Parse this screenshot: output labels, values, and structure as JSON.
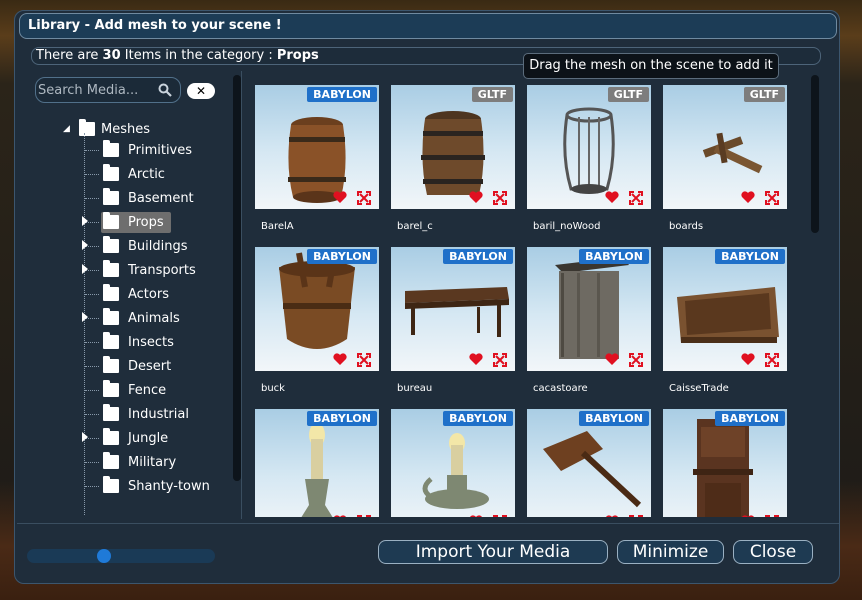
{
  "window": {
    "title": "Library - Add mesh to your scene !"
  },
  "info": {
    "prefix": "There are",
    "count": "30",
    "middle": "Items in the category :",
    "category": "Props"
  },
  "tooltip": "Drag the mesh on the scene to add it",
  "search": {
    "placeholder": "Search Media...",
    "value": "",
    "clear_label": "✕"
  },
  "tree": {
    "root": "Meshes",
    "items": [
      {
        "label": "Primitives",
        "expandable": false,
        "selected": false
      },
      {
        "label": "Arctic",
        "expandable": false,
        "selected": false
      },
      {
        "label": "Basement",
        "expandable": false,
        "selected": false
      },
      {
        "label": "Props",
        "expandable": true,
        "selected": true
      },
      {
        "label": "Buildings",
        "expandable": true,
        "selected": false
      },
      {
        "label": "Transports",
        "expandable": true,
        "selected": false
      },
      {
        "label": "Actors",
        "expandable": false,
        "selected": false
      },
      {
        "label": "Animals",
        "expandable": true,
        "selected": false
      },
      {
        "label": "Insects",
        "expandable": false,
        "selected": false
      },
      {
        "label": "Desert",
        "expandable": false,
        "selected": false
      },
      {
        "label": "Fence",
        "expandable": false,
        "selected": false
      },
      {
        "label": "Industrial",
        "expandable": false,
        "selected": false
      },
      {
        "label": "Jungle",
        "expandable": true,
        "selected": false
      },
      {
        "label": "Military",
        "expandable": false,
        "selected": false
      },
      {
        "label": "Shanty-town",
        "expandable": false,
        "selected": false
      }
    ]
  },
  "grid": {
    "items": [
      {
        "name": "BarelA",
        "badge": "BABYLON",
        "model": "barrel"
      },
      {
        "name": "barel_c",
        "badge": "GLTF",
        "model": "barrel-dark"
      },
      {
        "name": "baril_noWood",
        "badge": "GLTF",
        "model": "cage"
      },
      {
        "name": "boards",
        "badge": "GLTF",
        "model": "boards"
      },
      {
        "name": "buck",
        "badge": "BABYLON",
        "model": "bucket"
      },
      {
        "name": "bureau",
        "badge": "BABYLON",
        "model": "table"
      },
      {
        "name": "cacastoare",
        "badge": "BABYLON",
        "model": "outhouse"
      },
      {
        "name": "CaisseTrade",
        "badge": "BABYLON",
        "model": "crate"
      },
      {
        "name": "",
        "badge": "BABYLON",
        "model": "candle"
      },
      {
        "name": "",
        "badge": "BABYLON",
        "model": "candle-holder"
      },
      {
        "name": "",
        "badge": "BABYLON",
        "model": "mallet"
      },
      {
        "name": "",
        "badge": "BABYLON",
        "model": "stove"
      }
    ]
  },
  "slider": {
    "value": 0.4
  },
  "buttons": {
    "import": "Import Your Media",
    "minimize": "Minimize",
    "close": "Close"
  },
  "colors": {
    "badge_babylon": "#1f70c9",
    "badge_gltf": "#7d7d7d",
    "favorite": "#e01020",
    "expand": "#e01020"
  }
}
